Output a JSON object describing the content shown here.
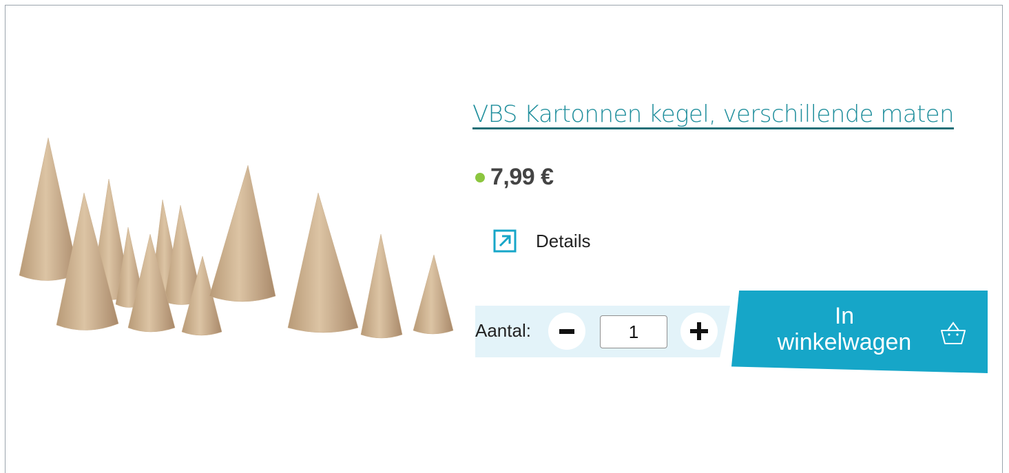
{
  "product": {
    "title": "VBS Kartonnen kegel, verschillende maten",
    "price": "7,99 €",
    "availability_color": "#8cc63f",
    "image_icon": "paper-cone-product-photo"
  },
  "details": {
    "label": "Details",
    "icon": "external-arrow-icon"
  },
  "quantity": {
    "label": "Aantal:",
    "value": "1",
    "minus_icon": "minus-icon",
    "plus_icon": "plus-icon"
  },
  "cart": {
    "label_line1": "In",
    "label_line2": "winkelwagen",
    "icon": "basket-icon",
    "color": "#16a6c8"
  },
  "colors": {
    "accent": "#1e8e9c",
    "band": "#e3f3f9"
  }
}
